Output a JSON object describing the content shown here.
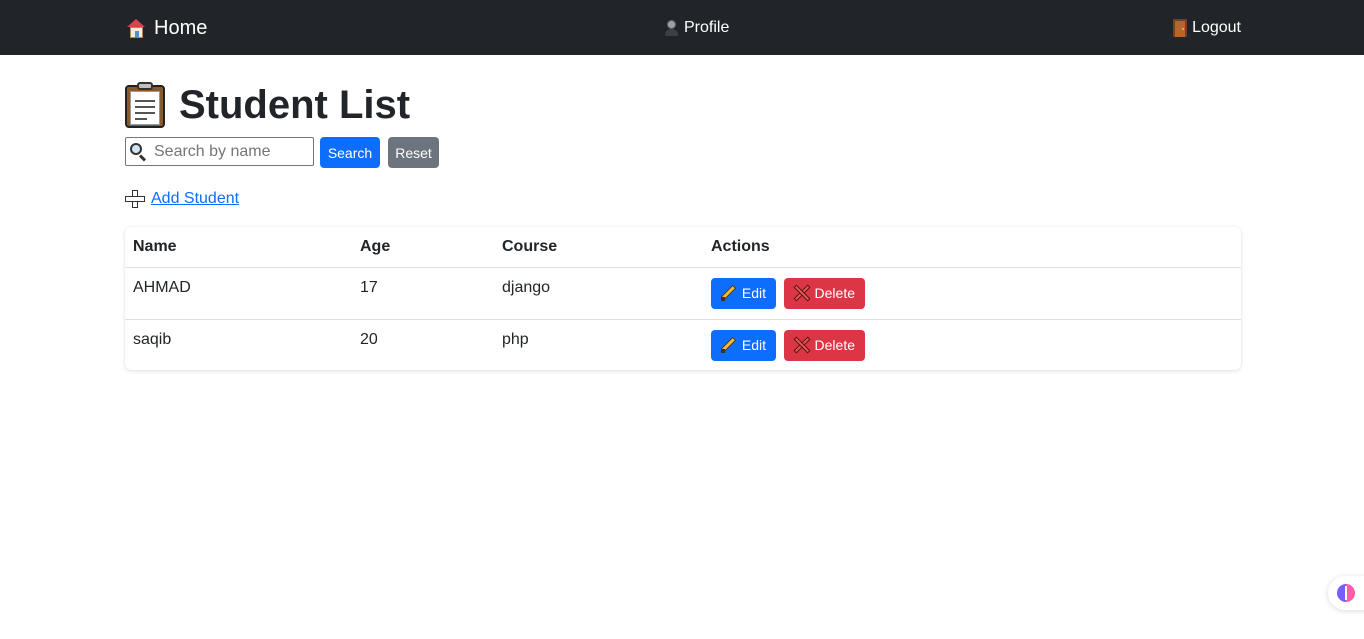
{
  "navbar": {
    "brand_label": "Home",
    "profile_label": "Profile",
    "logout_label": "Logout",
    "background": "#212529"
  },
  "page": {
    "title": "Student List"
  },
  "search": {
    "placeholder": "Search by name",
    "value": "",
    "search_label": "Search",
    "reset_label": "Reset"
  },
  "add_student_label": "Add Student",
  "table": {
    "headers": [
      "Name",
      "Age",
      "Course",
      "Actions"
    ],
    "rows": [
      {
        "name": "AHMAD",
        "age": "17",
        "course": "django",
        "edit_label": "Edit",
        "delete_label": "Delete"
      },
      {
        "name": "saqib",
        "age": "20",
        "course": "php",
        "edit_label": "Edit",
        "delete_label": "Delete"
      }
    ]
  },
  "icons": {
    "brand": "house-icon",
    "profile": "person-icon",
    "logout": "door-icon",
    "title": "clipboard-icon",
    "search": "magnifier-icon",
    "add": "plus-icon",
    "edit": "pencil-icon",
    "delete": "cross-icon",
    "widget": "brain-icon"
  },
  "colors": {
    "primary": "#0d6efd",
    "secondary": "#6c757d",
    "danger": "#dc3545",
    "text": "#212529"
  }
}
